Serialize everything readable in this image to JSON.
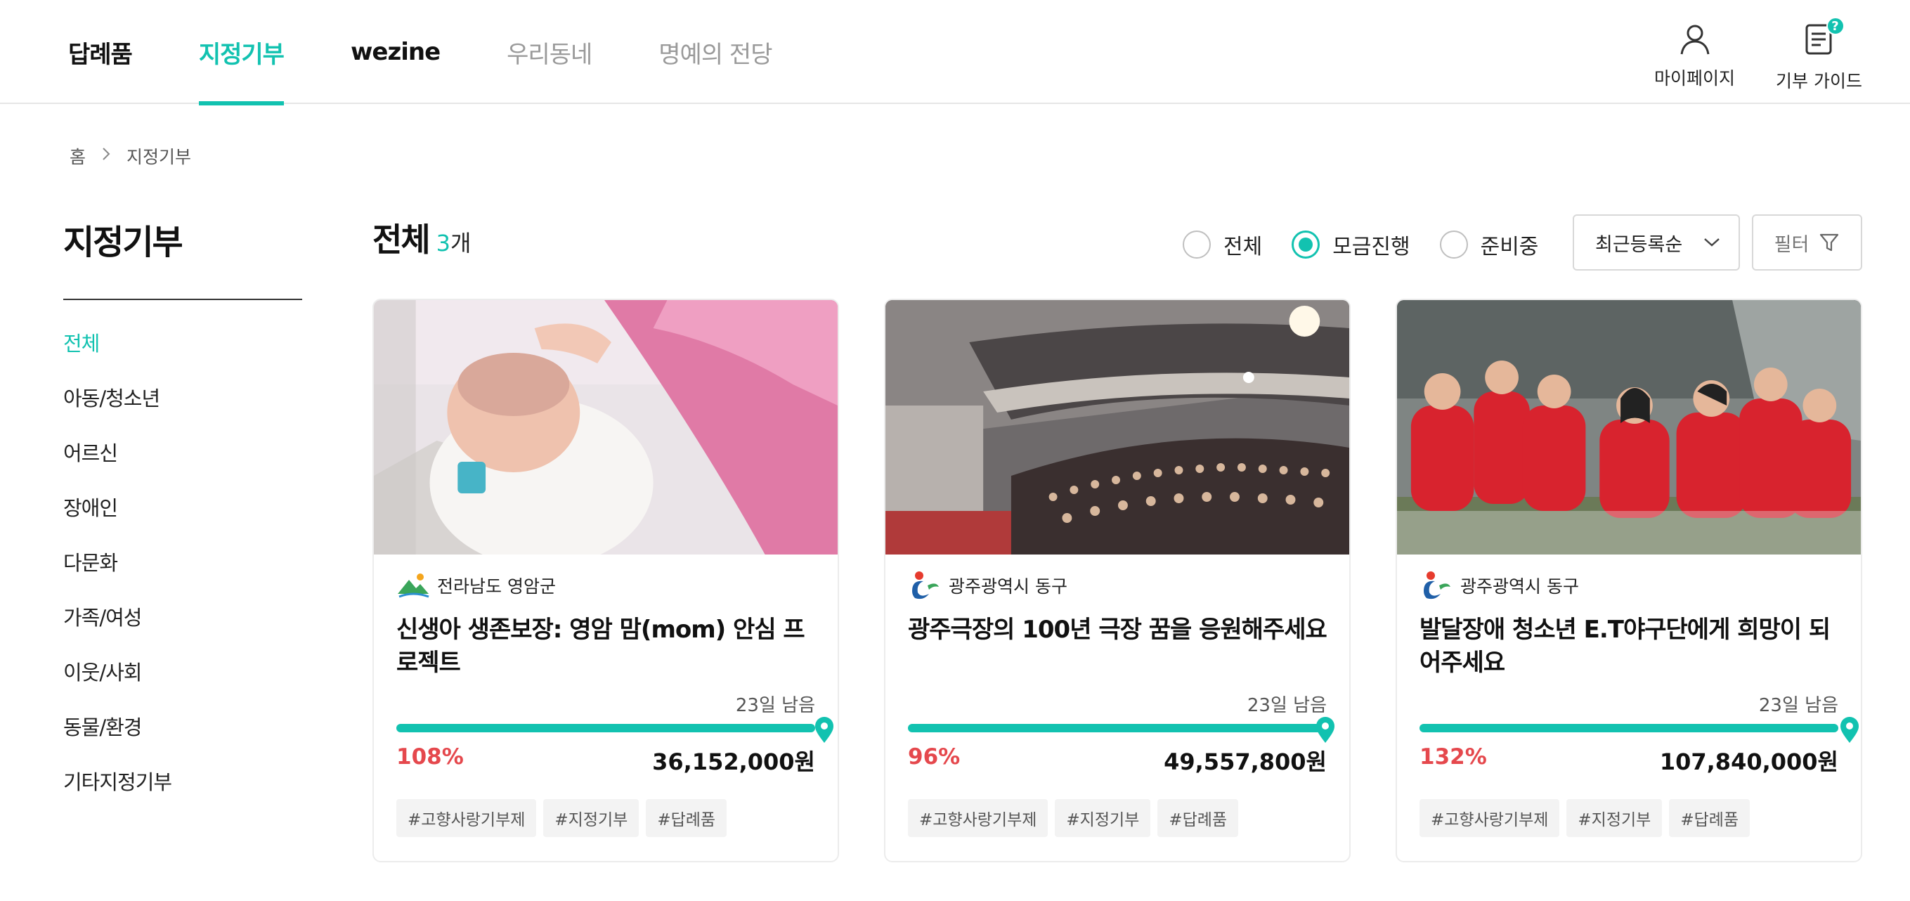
{
  "nav": {
    "items": [
      {
        "label": "답례품",
        "state": "normal"
      },
      {
        "label": "지정기부",
        "state": "active"
      },
      {
        "label": "wezine",
        "state": "normal"
      },
      {
        "label": "우리동네",
        "state": "muted"
      },
      {
        "label": "명예의 전당",
        "state": "muted"
      }
    ],
    "mypage_label": "마이페이지",
    "guide_label": "기부 가이드",
    "guide_badge": "?"
  },
  "breadcrumb": {
    "home": "홈",
    "sep": ">",
    "current": "지정기부"
  },
  "sidebar": {
    "title": "지정기부",
    "items": [
      {
        "label": "전체",
        "active": true
      },
      {
        "label": "아동/청소년",
        "active": false
      },
      {
        "label": "어르신",
        "active": false
      },
      {
        "label": "장애인",
        "active": false
      },
      {
        "label": "다문화",
        "active": false
      },
      {
        "label": "가족/여성",
        "active": false
      },
      {
        "label": "이웃/사회",
        "active": false
      },
      {
        "label": "동물/환경",
        "active": false
      },
      {
        "label": "기타지정기부",
        "active": false
      }
    ]
  },
  "main": {
    "title": "전체",
    "count": "3",
    "count_unit": "개",
    "radios": [
      {
        "label": "전체",
        "selected": false
      },
      {
        "label": "모금진행",
        "selected": true
      },
      {
        "label": "준비중",
        "selected": false
      }
    ],
    "sort": {
      "selected": "최근등록순"
    },
    "filter_label": "필터"
  },
  "cards": [
    {
      "org": "전라남도 영암군",
      "title": "신생아 생존보장: 영암 맘(mom) 안심 프로젝트",
      "remaining": "23일 남음",
      "percent_label": "108%",
      "percent": 108,
      "amount": "36,152,000원",
      "tags": [
        "#고향사랑기부제",
        "#지정기부",
        "#답례품"
      ]
    },
    {
      "org": "광주광역시 동구",
      "title": "광주극장의 100년 극장 꿈을 응원해주세요",
      "remaining": "23일 남음",
      "percent_label": "96%",
      "percent": 96,
      "amount": "49,557,800원",
      "tags": [
        "#고향사랑기부제",
        "#지정기부",
        "#답례품"
      ]
    },
    {
      "org": "광주광역시 동구",
      "title": "발달장애 청소년 E.T야구단에게 희망이 되어주세요",
      "remaining": "23일 남음",
      "percent_label": "132%",
      "percent": 132,
      "amount": "107,840,000원",
      "tags": [
        "#고향사랑기부제",
        "#지정기부",
        "#답례품"
      ]
    }
  ],
  "colors": {
    "accent": "#12c2b0",
    "percent": "#e5484d"
  }
}
